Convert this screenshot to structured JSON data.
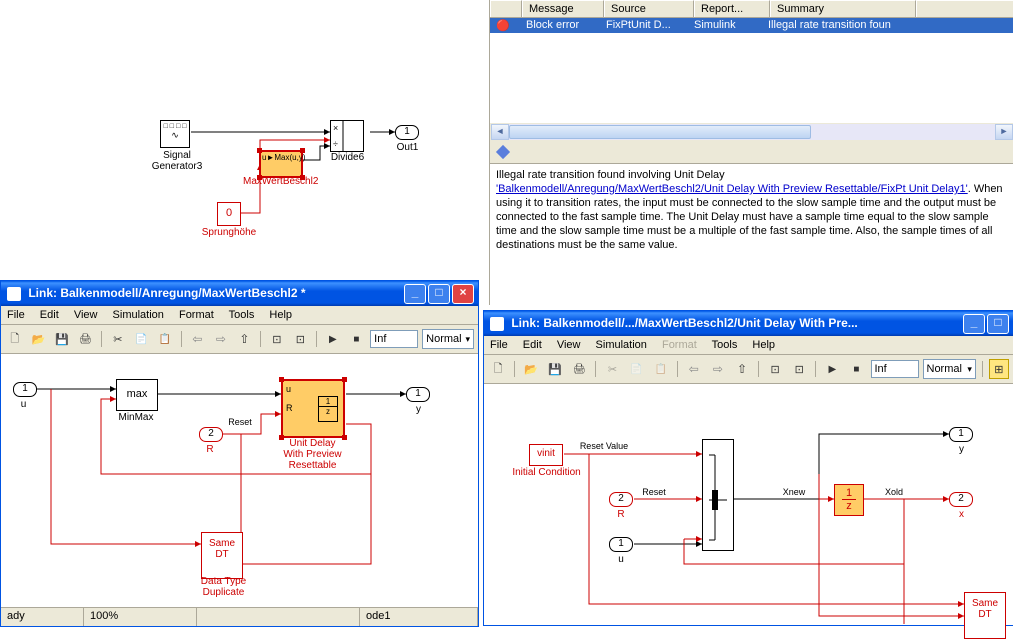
{
  "top_diagram": {
    "signal_gen_label": "Signal\nGenerator3",
    "sprung_label": "Sprunghöhe",
    "sprung_value": "0",
    "divide_label": "Divide6",
    "out1_label": "Out1",
    "out1_port": "1",
    "max_label": "MaxWertBeschl2",
    "max_blk": "Max(u,y)"
  },
  "err_list": {
    "cols": [
      "Message",
      "Source",
      "Report...",
      "Summary"
    ],
    "row": {
      "msg": "Block error",
      "src": "FixPtUnit D...",
      "rpt": "Simulink",
      "sum": "Illegal rate transition foun"
    },
    "detail_line1": "Illegal rate transition found involving Unit Delay",
    "detail_link": "'Balkenmodell/Anregung/MaxWertBeschl2/Unit Delay With Preview Resettable/FixPt Unit Delay1'",
    "detail_rest": ". When using it to transition rates, the input must be connected to the slow sample time and the output must be connected to the fast sample time. The Unit Delay must have a sample time equal to the slow sample time and the slow sample time must be a multiple of the fast sample time. Also, the sample times of all destinations must be the same value."
  },
  "win1": {
    "title": "Link: Balkenmodell/Anregung/MaxWertBeschl2 *",
    "menus": [
      "File",
      "Edit",
      "View",
      "Simulation",
      "Format",
      "Tools",
      "Help"
    ],
    "inf": "Inf",
    "mode": "Normal",
    "u_port": "1",
    "u_lbl": "u",
    "r_port": "2",
    "r_lbl": "R",
    "r_txt": "Reset",
    "minmax": "max",
    "minmax_lbl": "MinMax",
    "ud_lbl": "Unit Delay\nWith Preview\nResettable",
    "y_port": "1",
    "y_lbl": "y",
    "dt_lbl": "Same\nDT",
    "dt_lbl2": "Data Type\nDuplicate",
    "status": [
      "ady",
      "100%",
      "",
      "ode1"
    ]
  },
  "win2": {
    "title": "Link: Balkenmodell/.../MaxWertBeschl2/Unit Delay With Pre...",
    "menus": [
      "File",
      "Edit",
      "View",
      "Simulation",
      "Format",
      "Tools",
      "Help"
    ],
    "inf": "Inf",
    "mode": "Normal",
    "vinit": "vinit",
    "vinit_lbl": "Initial Condition",
    "rv_txt": "Reset Value",
    "r_port": "2",
    "r_lbl": "R",
    "r_txt": "Reset",
    "u_port": "1",
    "u_lbl": "u",
    "y_port": "1",
    "y_lbl": "y",
    "x_port": "2",
    "x_lbl": "x",
    "z_top": "1",
    "z_bot": "z",
    "xnew": "Xnew",
    "xold": "Xold",
    "dt_lbl": "Same\nDT"
  }
}
